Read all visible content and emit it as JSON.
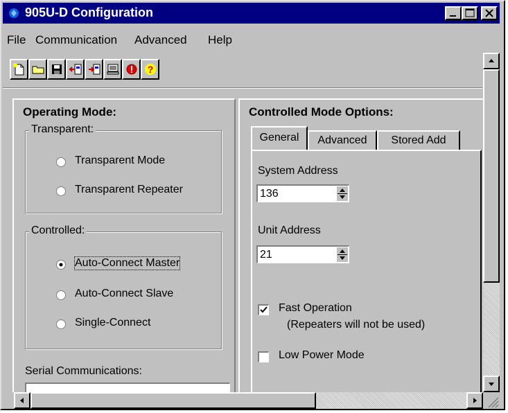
{
  "window": {
    "title": "905U-D Configuration"
  },
  "menu": [
    "File",
    "Communication",
    "Advanced",
    "Help"
  ],
  "toolbar": [
    "new-icon",
    "open-icon",
    "save-icon",
    "read-icon",
    "write-icon",
    "monitor-icon",
    "diagnostics-icon",
    "help-icon"
  ],
  "operating_mode": {
    "title": "Operating Mode:",
    "transparent": {
      "label": "Transparent:",
      "options": [
        "Transparent Mode",
        "Transparent Repeater"
      ]
    },
    "controlled": {
      "label": "Controlled:",
      "options": [
        "Auto-Connect Master",
        "Auto-Connect Slave",
        "Single-Connect"
      ],
      "selected": "Auto-Connect Master"
    },
    "serial_label": "Serial Communications:"
  },
  "controlled_options": {
    "title": "Controlled Mode Options:",
    "tabs": [
      "General",
      "Advanced",
      "Stored Add"
    ],
    "active_tab": "General",
    "system_address": {
      "label": "System Address",
      "value": "136"
    },
    "unit_address": {
      "label": "Unit Address",
      "value": "21"
    },
    "fast_operation": {
      "label": "Fast Operation",
      "note": "(Repeaters will not be used)",
      "checked": true
    },
    "low_power": {
      "label": "Low Power Mode",
      "checked": false
    }
  }
}
